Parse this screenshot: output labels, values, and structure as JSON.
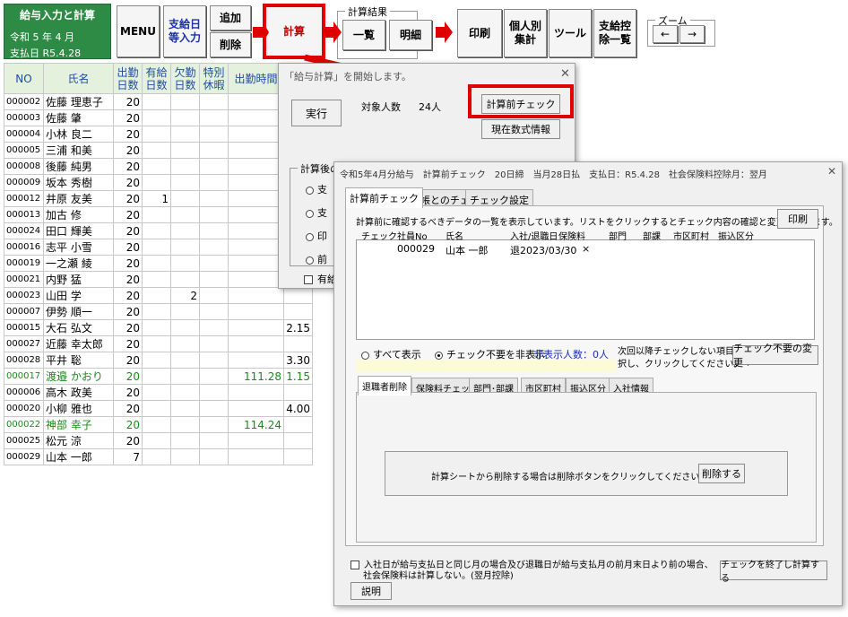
{
  "green_panel": {
    "title": "給与入力と計算",
    "date_line": "令和 5 年 4 月",
    "pay_day": "支払日 R5.4.28"
  },
  "toolbar": {
    "menu": "MENU",
    "payday_input": "支給日\n等入力",
    "add": "追加",
    "delete": "削除",
    "calc": "計算",
    "result_group": "計算結果",
    "list": "一覧",
    "detail": "明細",
    "print": "印刷",
    "personal": "個人別\n集計",
    "tools": "ツール",
    "deduction": "支給控\n除一覧",
    "zoom_group": "ズーム",
    "zoom_left": "←",
    "zoom_right": "→"
  },
  "sheet": {
    "headers": [
      "NO",
      "氏名",
      "出勤\n日数",
      "有給\n日数",
      "欠勤\n日数",
      "特別\n休暇",
      "出勤時間"
    ],
    "rows": [
      {
        "no": "000002",
        "name": "佐藤 理恵子",
        "days": "20",
        "paid": "",
        "absent": "",
        "hours": "",
        "extra": ""
      },
      {
        "no": "000003",
        "name": "佐藤 肇",
        "days": "20",
        "paid": "",
        "absent": "",
        "hours": "",
        "extra": ""
      },
      {
        "no": "000004",
        "name": "小林 良二",
        "days": "20",
        "paid": "",
        "absent": "",
        "hours": "",
        "extra": ""
      },
      {
        "no": "000005",
        "name": "三浦 和美",
        "days": "20",
        "paid": "",
        "absent": "",
        "hours": "",
        "extra": ""
      },
      {
        "no": "000008",
        "name": "後藤 純男",
        "days": "20",
        "paid": "",
        "absent": "",
        "hours": "",
        "extra": ""
      },
      {
        "no": "000009",
        "name": "坂本 秀樹",
        "days": "20",
        "paid": "",
        "absent": "",
        "hours": "",
        "extra": ""
      },
      {
        "no": "000012",
        "name": "井原 友美",
        "days": "20",
        "paid": "1",
        "absent": "",
        "hours": "",
        "extra": ""
      },
      {
        "no": "000013",
        "name": "加古 修",
        "days": "20",
        "paid": "",
        "absent": "",
        "hours": "",
        "extra": ""
      },
      {
        "no": "000024",
        "name": "田口 輝美",
        "days": "20",
        "paid": "",
        "absent": "",
        "hours": "",
        "extra": ""
      },
      {
        "no": "000016",
        "name": "志平 小雪",
        "days": "20",
        "paid": "",
        "absent": "",
        "hours": "",
        "extra": ""
      },
      {
        "no": "000019",
        "name": "一之瀬 綾",
        "days": "20",
        "paid": "",
        "absent": "",
        "hours": "",
        "extra": ""
      },
      {
        "no": "000021",
        "name": "内野 猛",
        "days": "20",
        "paid": "",
        "absent": "",
        "hours": "",
        "extra": ""
      },
      {
        "no": "000023",
        "name": "山田 学",
        "days": "20",
        "paid": "",
        "absent": "2",
        "hours": "",
        "extra": ""
      },
      {
        "no": "000007",
        "name": "伊勢 順一",
        "days": "20",
        "paid": "",
        "absent": "",
        "hours": "",
        "extra": ""
      },
      {
        "no": "000015",
        "name": "大石 弘文",
        "days": "20",
        "paid": "",
        "absent": "",
        "hours": "",
        "extra": "2.15"
      },
      {
        "no": "000027",
        "name": "近藤 幸太郎",
        "days": "20",
        "paid": "",
        "absent": "",
        "hours": "",
        "extra": ""
      },
      {
        "no": "000028",
        "name": "平井 聡",
        "days": "20",
        "paid": "",
        "absent": "",
        "hours": "",
        "extra": "3.30"
      },
      {
        "no": "000017",
        "name": "渡邉 かおり",
        "days": "20",
        "paid": "",
        "absent": "",
        "hours": "111.28",
        "extra": "1.15"
      },
      {
        "no": "000006",
        "name": "高木 政美",
        "days": "20",
        "paid": "",
        "absent": "",
        "hours": "",
        "extra": ""
      },
      {
        "no": "000020",
        "name": "小柳 雅也",
        "days": "20",
        "paid": "",
        "absent": "",
        "hours": "",
        "extra": "4.00"
      },
      {
        "no": "000022",
        "name": "神部 幸子",
        "days": "20",
        "paid": "",
        "absent": "",
        "hours": "114.24",
        "extra": ""
      },
      {
        "no": "000025",
        "name": "松元 涼",
        "days": "20",
        "paid": "",
        "absent": "",
        "hours": "",
        "extra": ""
      },
      {
        "no": "000029",
        "name": "山本 一郎",
        "days": "7",
        "paid": "",
        "absent": "",
        "hours": "",
        "extra": ""
      }
    ]
  },
  "calc_dialog": {
    "title": "「給与計算」を開始します。",
    "run": "実行",
    "target_label": "対象人数",
    "target_value": "24人",
    "precheck": "計算前チェック",
    "formula": "現在数式情報",
    "after_group": "計算後の",
    "options": [
      "支",
      "支",
      "印",
      "前"
    ],
    "checkbox": "有給"
  },
  "check_dialog": {
    "title": "令和5年4月分給与　計算前チェック　20日締　当月28日払　支払日：R5.4.28　社会保険料控除月：翌月",
    "tabs": [
      "計算前チェック",
      "台帳とのチェック",
      "チェック設定"
    ],
    "desc": "計算前に確認するべきデータの一覧を表示しています。リストをクリックするとチェック内容の確認と変更ができます。",
    "print": "印刷",
    "columns": [
      "チェック",
      "社員No",
      "氏名",
      "入社/退職日",
      "保険料",
      "部門",
      "部課",
      "市区町村",
      "振込区分"
    ],
    "row": {
      "emp": "000029",
      "name": "山本 一郎",
      "date": "退2023/03/30",
      "ins": "×"
    },
    "show_all": "すべて表示",
    "hide_unneeded": "チェック不要を非表示",
    "hidden_count": "非表示人数：0人",
    "next_note1": "次回以降チェックしない項目を選",
    "next_note2": "択し、クリックしてください。⇒",
    "change_btn": "チェック不要の変更",
    "subtabs": [
      "退職者削除",
      "保険料チェック",
      "部門･部課",
      "市区町村",
      "振込区分",
      "入社情報"
    ],
    "delete_msg": "計算シートから削除する場合は削除ボタンをクリックしてください。",
    "delete_btn": "削除する",
    "footer1": "入社日が給与支払日と同じ月の場合及び退職日が給与支払月の前月末日より前の場合、",
    "footer2": "社会保険料は計算しない。(翌月控除)",
    "finish_btn": "チェックを終了し計算する",
    "explain_btn": "説明"
  },
  "colors": {
    "green": "#2e8b45",
    "red": "#e00000",
    "blue": "#1a2fb0"
  }
}
